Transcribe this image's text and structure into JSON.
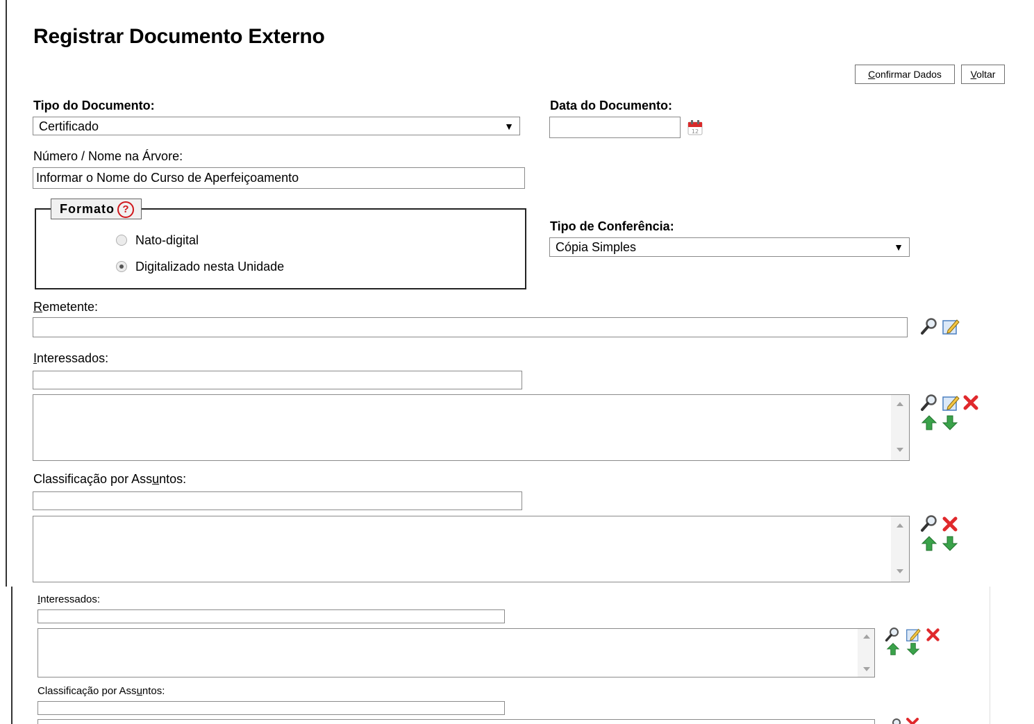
{
  "page": {
    "title": "Registrar Documento Externo"
  },
  "toolbar": {
    "confirm_label": "Confirmar Dados",
    "confirm_accesskey": "C",
    "confirm_rest": "onfirmar Dados",
    "back_label": "Voltar",
    "back_accesskey": "V",
    "back_rest": "oltar"
  },
  "form": {
    "tipo_documento": {
      "label": "Tipo do Documento:",
      "value": "Certificado"
    },
    "data_documento": {
      "label": "Data do Documento:",
      "value": ""
    },
    "numero_nome": {
      "label": "Número / Nome na Árvore:",
      "value": "Informar o Nome do Curso de Aperfeiçoamento"
    },
    "formato": {
      "legend": "Formato",
      "help": "?",
      "options": [
        {
          "label": "Nato-digital",
          "selected": false
        },
        {
          "label": "Digitalizado nesta Unidade",
          "selected": true
        }
      ]
    },
    "tipo_conferencia": {
      "label": "Tipo de Conferência:",
      "value": "Cópia Simples"
    },
    "remetente": {
      "label_key": "R",
      "label_rest": "emetente:",
      "value": ""
    },
    "interessados": {
      "label_key": "I",
      "label_rest": "nteressados:",
      "value": ""
    },
    "classificacao": {
      "label_pre": "Classificação por Ass",
      "label_key": "u",
      "label_post": "ntos:",
      "value": ""
    }
  },
  "lower_panel": {
    "interessados": {
      "label_key": "I",
      "label_rest": "nteressados:"
    },
    "classificacao": {
      "label_pre": "Classificação por Ass",
      "label_key": "u",
      "label_post": "ntos:"
    }
  },
  "colors": {
    "accent_red": "#d0161b",
    "arrow_green": "#3aa24a"
  }
}
